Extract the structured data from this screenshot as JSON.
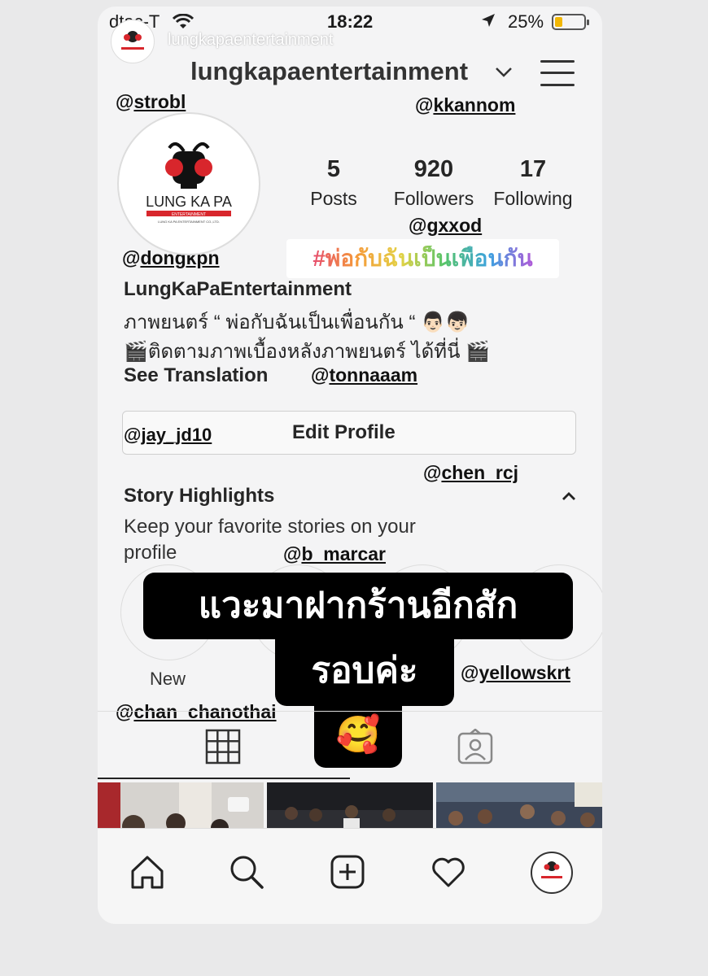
{
  "status_bar": {
    "carrier": "dtac-T",
    "time": "18:22",
    "battery": "25%",
    "battery_level": 0.25
  },
  "story_overlay": {
    "username": "lungkapaentertainment"
  },
  "header": {
    "username": "lungkapaentertainment"
  },
  "profile": {
    "avatar_logo": {
      "text": "LUNG KA PA",
      "sub": "ENTERTAINMENT",
      "small": "LUNG KA PA ENTERTAINMENT CO.,LTD."
    },
    "stats": [
      {
        "value": "5",
        "label": "Posts"
      },
      {
        "value": "920",
        "label": "Followers"
      },
      {
        "value": "17",
        "label": "Following"
      }
    ],
    "display_name": "LungKaPaEntertainment",
    "bio_line1": "ภาพยนตร์ “ พ่อกับฉันเป็นเพื่อนกัน “ 👨🏻👦🏻",
    "bio_line2": "🎬ติดตามภาพเบื้องหลังภาพยนตร์ ได้ที่นี่ 🎬",
    "see_translation": "See Translation",
    "edit_profile": "Edit Profile"
  },
  "hashtag_sticker": "#พ่อกับฉันเป็นเพื่อนกัน",
  "mentions": [
    {
      "at": "@",
      "user": "strobl"
    },
    {
      "at": "@",
      "user": "kkannom"
    },
    {
      "at": "@",
      "user": "gxxod"
    },
    {
      "at": "@",
      "user": "dongkpn"
    },
    {
      "at": "@",
      "user": "tonnaaam"
    },
    {
      "at": "@",
      "user": "jay_jd10"
    },
    {
      "at": "@",
      "user": "chen_rcj"
    },
    {
      "at": "@",
      "user": "b_marcar"
    },
    {
      "at": "@",
      "user": "yellowskrt"
    },
    {
      "at": "@",
      "user": "chan_chanothai"
    }
  ],
  "story_highlights": {
    "title": "Story Highlights",
    "description": "Keep your favorite stories on your profile",
    "new_label": "New"
  },
  "text_sticker": {
    "line1": "แวะมาฝากร้านอีกสัก",
    "line2": "รอบค่ะ",
    "emoji": "🥰"
  },
  "nav": {
    "icons": [
      "home-icon",
      "search-icon",
      "add-post-icon",
      "heart-icon",
      "profile-avatar"
    ]
  },
  "colors": {
    "logo_red": "#d8262c",
    "sticker_bg": "#000000",
    "battery": "#f2b705"
  }
}
